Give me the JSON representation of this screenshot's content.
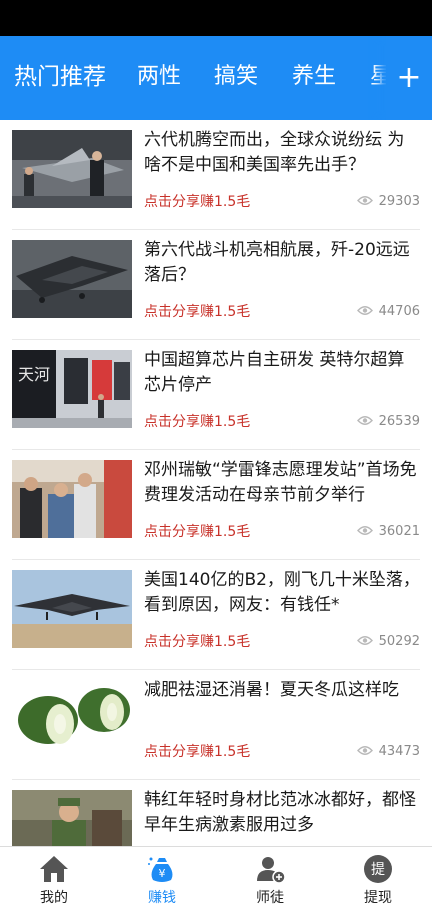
{
  "tabs": [
    {
      "label": "热门推荐"
    },
    {
      "label": "两性"
    },
    {
      "label": "搞笑"
    },
    {
      "label": "养生"
    },
    {
      "label": "星"
    }
  ],
  "add_tab_label": "+",
  "share_label": "点击分享赚1.5毛",
  "articles": [
    {
      "title": "六代机腾空而出，全球众说纷纭 为啥不是中国和美国率先出手？",
      "views": "29303",
      "thumb": "jet-expo-photo"
    },
    {
      "title": "第六代战斗机亮相航展，歼-20远远落后？",
      "views": "44706",
      "thumb": "stealth-jet-photo"
    },
    {
      "title": "中国超算芯片自主研发 英特尔超算芯片停产",
      "views": "26539",
      "thumb": "supercomputer-photo",
      "thumb_text": "天河"
    },
    {
      "title": "邓州瑞敏“学雷锋志愿理发站”首场免费理发活动在母亲节前夕举行",
      "views": "36021",
      "thumb": "haircut-event-photo"
    },
    {
      "title": "美国140亿的B2，刚飞几十米坠落，看到原因，网友：有钱任*",
      "views": "50292",
      "thumb": "b2-bomber-photo"
    },
    {
      "title": "减肥祛湿还消暑！夏天冬瓜这样吃",
      "views": "43473",
      "thumb": "winter-melon-photo"
    },
    {
      "title": "韩红年轻时身材比范冰冰都好，都怪早年生病激素服用过多",
      "views": "",
      "thumb": "soldier-photo"
    }
  ],
  "bottom_nav": [
    {
      "label": "我的",
      "icon": "home-icon",
      "active": false
    },
    {
      "label": "赚钱",
      "icon": "money-bag-icon",
      "active": true
    },
    {
      "label": "师徒",
      "icon": "add-person-icon",
      "active": false
    },
    {
      "label": "提现",
      "icon": "withdraw-icon",
      "active": false
    }
  ],
  "colors": {
    "accent": "#1e8cf5",
    "share_red": "#c8322a",
    "status_bar": "#000000"
  }
}
